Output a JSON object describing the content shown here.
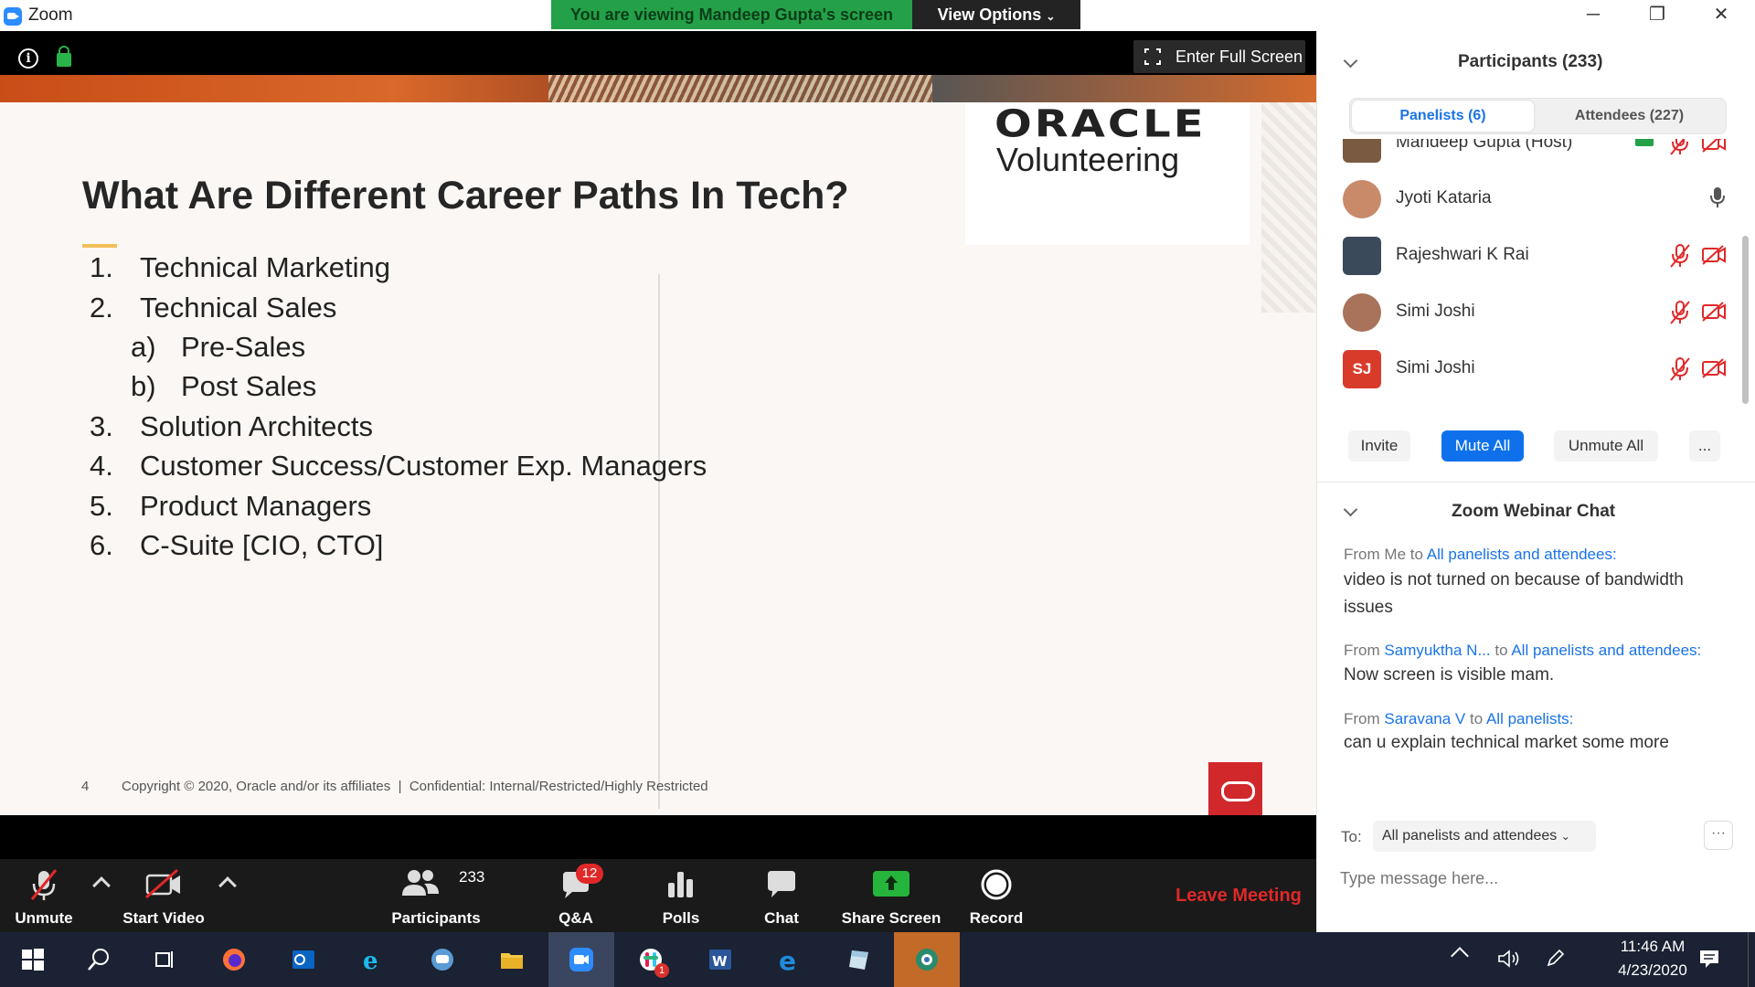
{
  "window": {
    "app_title": "Zoom",
    "viewing_banner": "You are viewing Mandeep Gupta's screen",
    "view_options": "View Options",
    "minimize": "─",
    "restore": "❐",
    "close": "✕"
  },
  "share": {
    "fullscreen_label": "Enter Full Screen"
  },
  "slide": {
    "title": "What Are Different Career Paths In Tech?",
    "logo_main": "ORACLE",
    "logo_sub": "Volunteering",
    "items": [
      {
        "num": "1.",
        "text": "Technical Marketing"
      },
      {
        "num": "2.",
        "text": "Technical Sales"
      },
      {
        "num": "a)",
        "text": "Pre-Sales"
      },
      {
        "num": "b)",
        "text": "Post Sales"
      },
      {
        "num": "3.",
        "text": "Solution Architects"
      },
      {
        "num": "4.",
        "text": "Customer Success/Customer Exp. Managers"
      },
      {
        "num": "5.",
        "text": "Product Managers"
      },
      {
        "num": "6.",
        "text": "C-Suite [CIO, CTO]"
      }
    ],
    "page_number": "4",
    "copyright": "Copyright © 2020, Oracle and/or its affiliates  |  Confidential: Internal/Restricted/Highly Restricted"
  },
  "toolbar": {
    "unmute": "Unmute",
    "start_video": "Start Video",
    "participants": "Participants",
    "participants_count": "233",
    "qa": "Q&A",
    "qa_badge": "12",
    "polls": "Polls",
    "chat": "Chat",
    "share_screen": "Share Screen",
    "record": "Record",
    "leave": "Leave Meeting"
  },
  "participants_panel": {
    "title": "Participants (233)",
    "tab_panelists": "Panelists (6)",
    "tab_attendees": "Attendees (227)",
    "people": [
      {
        "name": "Mandeep Gupta (Host)",
        "initials": ""
      },
      {
        "name": "Jyoti Kataria",
        "initials": ""
      },
      {
        "name": "Rajeshwari K Rai",
        "initials": ""
      },
      {
        "name": "Simi Joshi",
        "initials": ""
      },
      {
        "name": "Simi Joshi",
        "initials": "SJ"
      }
    ],
    "invite": "Invite",
    "mute_all": "Mute All",
    "unmute_all": "Unmute All",
    "more": "..."
  },
  "chat_panel": {
    "title": "Zoom Webinar Chat",
    "messages": [
      {
        "from_word": "From",
        "sender": "Me",
        "to_word": "to",
        "recipient": "All panelists and attendees:",
        "text": "video is not turned on because of bandwidth issues"
      },
      {
        "from_word": "From",
        "sender": "Samyuktha N...",
        "to_word": "to",
        "recipient": "All panelists and attendees:",
        "text": "Now screen is visible mam."
      },
      {
        "from_word": "From",
        "sender": "Saravana V",
        "to_word": "to",
        "recipient": "All panelists:",
        "text": "can u explain technical market some more"
      }
    ],
    "to_label": "To:",
    "to_value": "All panelists and attendees",
    "more": "···",
    "input_placeholder": "Type message here..."
  },
  "taskbar": {
    "time": "11:46 AM",
    "date": "4/23/2020",
    "slack_badge": "1"
  },
  "colors": {
    "banner_green": "#24a148",
    "accent_blue": "#0e71eb",
    "leave_red": "#e02828",
    "oracle_red": "#d1282c"
  }
}
